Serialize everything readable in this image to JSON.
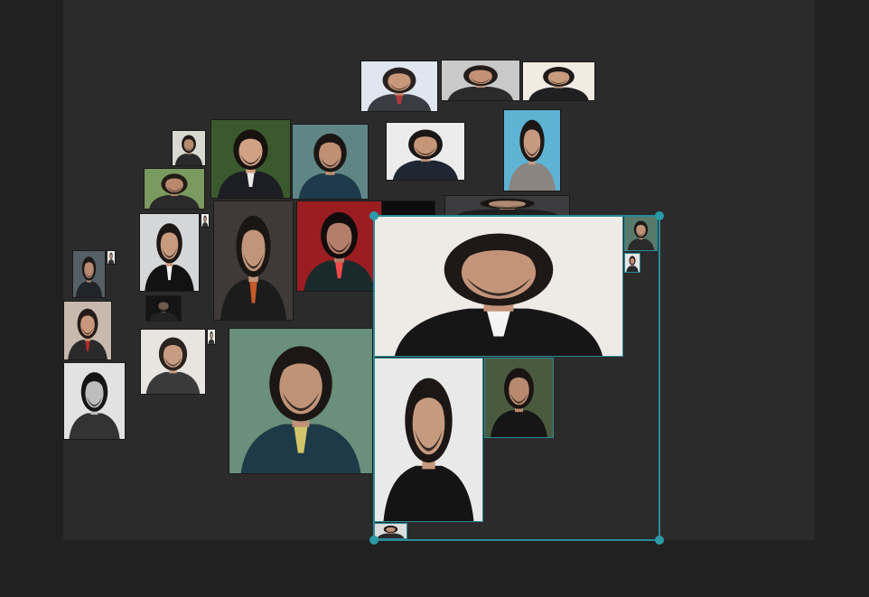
{
  "canvas": {
    "background": "#2b2b2b",
    "page_background": "#212121"
  },
  "selection": {
    "border_color": "#2a8a96",
    "handle_color": "#2a9aa6"
  },
  "photos": [
    {
      "id": "p-suit-arms",
      "bg": "#dfe6ef",
      "hair": "#2a2220",
      "skin": "#c9977a",
      "cloth": "#3b3b44",
      "accent": "#b23a3a"
    },
    {
      "id": "p-closeup-gray",
      "bg": "#c9c9c9",
      "hair": "#221c1a",
      "skin": "#c39276",
      "cloth": "#2b2b2b",
      "accent": null
    },
    {
      "id": "p-white-event",
      "bg": "#f1ebe2",
      "hair": "#201a18",
      "skin": "#c89b7e",
      "cloth": "#1f1f22",
      "accent": null
    },
    {
      "id": "p-small-outdoor",
      "bg": "#d8d8d0",
      "hair": "#1f1a18",
      "skin": "#b88a70",
      "cloth": "#2a2a2a",
      "accent": null
    },
    {
      "id": "p-young-tie",
      "bg": "#3a5a2e",
      "hair": "#18120f",
      "skin": "#d1a184",
      "cloth": "#1d1d24",
      "accent": "#e9e9e9"
    },
    {
      "id": "p-teal-suit",
      "bg": "#5f8585",
      "hair": "#1b1614",
      "skin": "#c09074",
      "cloth": "#1f3a4a",
      "accent": null
    },
    {
      "id": "p-fullbody-white",
      "bg": "#ececec",
      "hair": "#1a1615",
      "skin": "#c59578",
      "cloth": "#1e2732",
      "accent": null
    },
    {
      "id": "p-gray-suit-blue",
      "bg": "#5eb3d3",
      "hair": "#1c1716",
      "skin": "#c79a80",
      "cloth": "#8a857e",
      "accent": null
    },
    {
      "id": "p-garden",
      "bg": "#7b9a5f",
      "hair": "#231b18",
      "skin": "#b9896d",
      "cloth": "#2a2a2a",
      "accent": null
    },
    {
      "id": "p-bowtie",
      "bg": "#d5d6d8",
      "hair": "#1d1816",
      "skin": "#c89a7e",
      "cloth": "#121212",
      "accent": "#f2f2f2"
    },
    {
      "id": "p-carpet",
      "bg": "#3f3a37",
      "hair": "#1a1614",
      "skin": "#c2957a",
      "cloth": "#1c1c1c",
      "accent": "#c45a2a"
    },
    {
      "id": "p-red-neon",
      "bg": "#9b1d22",
      "hair": "#120d0c",
      "skin": "#b57e6a",
      "cloth": "#1a2a2a",
      "accent": "#f24a4a"
    },
    {
      "id": "p-dark-strip",
      "bg": "#1e1e1e",
      "hair": "#1a1614",
      "skin": "#a7866e",
      "cloth": "#2a2a2a",
      "accent": null
    },
    {
      "id": "p-left-long",
      "bg": "#555f66",
      "hair": "#1e1917",
      "skin": "#b88b72",
      "cloth": "#20252a",
      "accent": null
    },
    {
      "id": "p-left-smile",
      "bg": "#c7b9ad",
      "hair": "#241b18",
      "skin": "#c8987c",
      "cloth": "#2a2a2a",
      "accent": "#b12a2a"
    },
    {
      "id": "p-bw",
      "bg": "#e2e2e2",
      "hair": "#151515",
      "skin": "#bdbdbd",
      "cloth": "#333333",
      "accent": null
    },
    {
      "id": "p-tiny-dark",
      "bg": "#151515",
      "hair": "#111111",
      "skin": "#6f5a4c",
      "cloth": "#222222",
      "accent": null
    },
    {
      "id": "p-long-hair",
      "bg": "#e8e4e0",
      "hair": "#2b2320",
      "skin": "#c89c82",
      "cloth": "#3a3a3a",
      "accent": null
    },
    {
      "id": "p-blue-suit",
      "bg": "#6a8f7a",
      "hair": "#1c1715",
      "skin": "#c09378",
      "cloth": "#1e3a48",
      "accent": "#d2c56a"
    },
    {
      "id": "p-bowtie-large",
      "bg": "#eeeae6",
      "hair": "#1e1816",
      "skin": "#c49478",
      "cloth": "#161616",
      "accent": "#f4f4f4"
    },
    {
      "id": "p-small-green",
      "bg": "#577a6c",
      "hair": "#1e1917",
      "skin": "#bf9277",
      "cloth": "#2a2a2a",
      "accent": null
    },
    {
      "id": "p-tiny-portrait",
      "bg": "#e6e6e6",
      "hair": "#1e1816",
      "skin": "#c09074",
      "cloth": "#2a2a2a",
      "accent": null
    },
    {
      "id": "p-black-shirt",
      "bg": "#e9e9e9",
      "hair": "#1c1614",
      "skin": "#c69a7e",
      "cloth": "#141414",
      "accent": null
    },
    {
      "id": "p-profile",
      "bg": "#4a5a3e",
      "hair": "#1a1513",
      "skin": "#b8896e",
      "cloth": "#161616",
      "accent": null
    },
    {
      "id": "p-tiny-bottom",
      "bg": "#dcdcdc",
      "hair": "#1e1816",
      "skin": "#bf9276",
      "cloth": "#2a2a2a",
      "accent": null
    },
    {
      "id": "p-dark-behind",
      "bg": "#3c3c3e",
      "hair": "#1a1614",
      "skin": "#b08a72",
      "cloth": "#1f1f1f",
      "accent": null
    },
    {
      "id": "p-black-cover",
      "bg": "#0d0d0d",
      "hair": "#0d0d0d",
      "skin": "#0d0d0d",
      "cloth": "#0d0d0d",
      "accent": null
    },
    {
      "id": "p-mini-1",
      "bg": "#efefef",
      "hair": "#333333",
      "skin": "#c09074",
      "cloth": "#333333",
      "accent": null
    },
    {
      "id": "p-mini-2",
      "bg": "#efefef",
      "hair": "#333333",
      "skin": "#c09074",
      "cloth": "#333333",
      "accent": null
    },
    {
      "id": "p-mini-3",
      "bg": "#efefef",
      "hair": "#333333",
      "skin": "#c09074",
      "cloth": "#333333",
      "accent": null
    }
  ]
}
